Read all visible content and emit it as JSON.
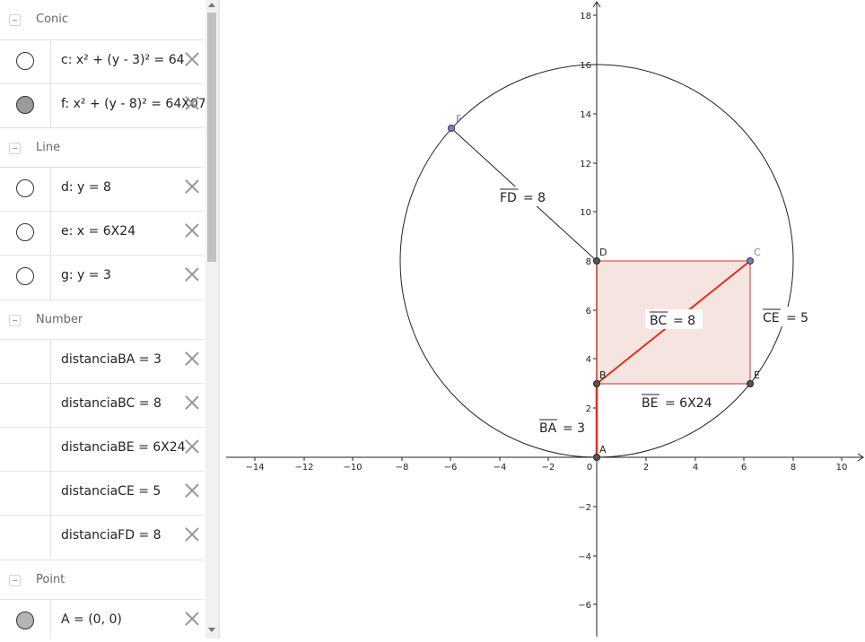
{
  "algebra": {
    "sections": [
      {
        "title": "Conic",
        "rows": [
          {
            "expr": "c: x² + (y - 3)² = 64",
            "visible": false
          },
          {
            "expr": "f: x² + (y - 8)² = 64X07",
            "visible": true
          }
        ]
      },
      {
        "title": "Line",
        "rows": [
          {
            "expr": "d: y = 8",
            "visible": false
          },
          {
            "expr": "e: x = 6X24",
            "visible": false
          },
          {
            "expr": "g: y = 3",
            "visible": false
          }
        ]
      },
      {
        "title": "Number",
        "rows": [
          {
            "expr": "distanciaBA = 3"
          },
          {
            "expr": "distanciaBC = 8"
          },
          {
            "expr": "distanciaBE = 6X24"
          },
          {
            "expr": "distanciaCE = 5"
          },
          {
            "expr": "distanciaFD = 8"
          }
        ]
      },
      {
        "title": "Point",
        "rows": [
          {
            "expr": "A = (0, 0)",
            "visible": true
          }
        ]
      }
    ]
  },
  "graphics": {
    "x_ticks": [
      "−14",
      "−12",
      "−10",
      "−8",
      "−6",
      "−4",
      "−2",
      "0",
      "2",
      "4",
      "6",
      "8",
      "10"
    ],
    "y_ticks": [
      "18",
      "16",
      "14",
      "12",
      "10",
      "8",
      "6",
      "4",
      "2",
      "−2",
      "−4",
      "−6"
    ],
    "points": {
      "A": "A",
      "B": "B",
      "C": "C",
      "D": "D",
      "E": "E",
      "F": "F"
    },
    "labels": {
      "fd": {
        "name": "FD",
        "value": "= 8"
      },
      "bc": {
        "name": "BC",
        "value": "= 8"
      },
      "ce": {
        "name": "CE",
        "value": "= 5"
      },
      "be": {
        "name": "BE",
        "value": "= 6X24"
      },
      "ba": {
        "name": "BA",
        "value": "= 3"
      }
    },
    "colors": {
      "segment": "#e0301e",
      "polygon_fill": "#f5e4e0",
      "polygon_stroke": "#c0392b",
      "point_blue": "#7b7bd6",
      "point_dark": "#333333"
    }
  }
}
